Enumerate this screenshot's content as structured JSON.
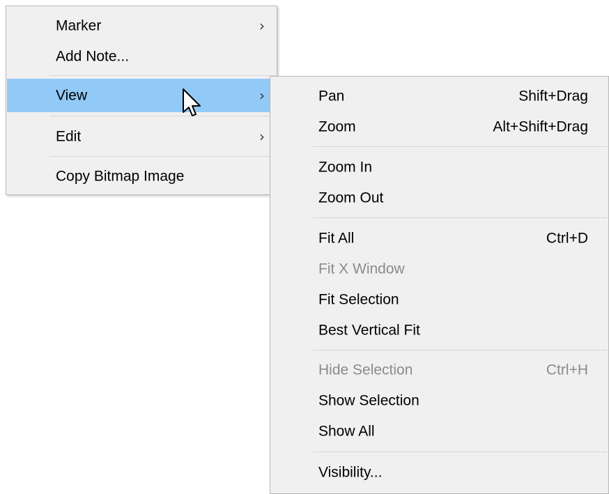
{
  "main_menu": {
    "items": [
      {
        "label": "Marker",
        "has_submenu": true
      },
      {
        "label": "Add Note..."
      },
      {
        "label": "View",
        "has_submenu": true,
        "highlighted": true
      },
      {
        "label": "Edit",
        "has_submenu": true
      },
      {
        "label": "Copy Bitmap Image"
      }
    ]
  },
  "view_submenu": {
    "items": [
      {
        "label": "Pan",
        "shortcut": "Shift+Drag"
      },
      {
        "label": "Zoom",
        "shortcut": "Alt+Shift+Drag"
      },
      {
        "label": "Zoom In"
      },
      {
        "label": "Zoom Out"
      },
      {
        "label": "Fit All",
        "shortcut": "Ctrl+D"
      },
      {
        "label": "Fit X Window",
        "disabled": true
      },
      {
        "label": "Fit Selection"
      },
      {
        "label": "Best Vertical Fit"
      },
      {
        "label": "Hide Selection",
        "shortcut": "Ctrl+H",
        "disabled": true
      },
      {
        "label": "Show Selection"
      },
      {
        "label": "Show All"
      },
      {
        "label": "Visibility..."
      }
    ]
  },
  "icons": {
    "submenu_arrow": "chevron-right-icon",
    "cursor": "mouse-pointer-icon"
  },
  "colors": {
    "menu_background": "#f0f0f0",
    "highlight": "#91c9f7",
    "disabled_text": "#8b8b8b",
    "separator": "#d5d5d5"
  }
}
